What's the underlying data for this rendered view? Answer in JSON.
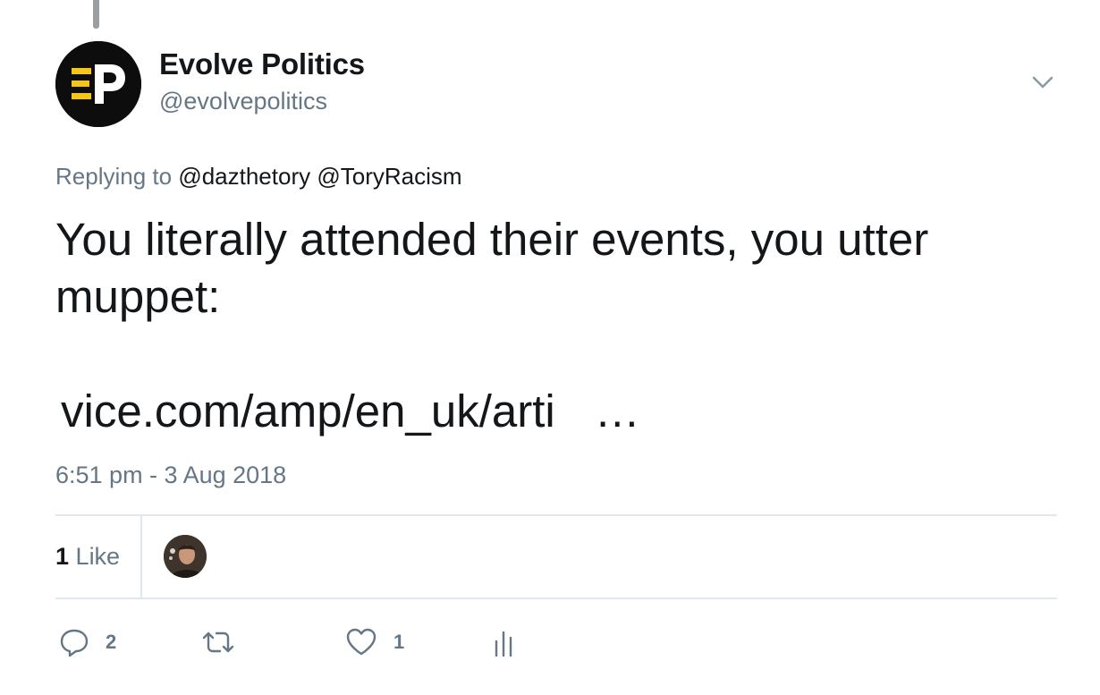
{
  "tweet": {
    "author": {
      "display_name": "Evolve Politics",
      "handle": "@evolvepolitics",
      "avatar_initials": "EP"
    },
    "replying_prefix": "Replying to",
    "replying_mentions": "@dazthetory @ToryRacism",
    "text": "You literally attended their events, you utter muppet:",
    "link_text": "vice.com/amp/en_uk/arti",
    "link_ellipsis": "…",
    "timestamp": "6:51 pm - 3 Aug 2018",
    "likes_number": "1",
    "likes_label": "Like"
  },
  "actions": {
    "reply_count": "2",
    "retweet_count": "",
    "like_count": "1"
  },
  "colors": {
    "text_primary": "#14171a",
    "text_secondary": "#657786",
    "divider": "#e1e8ed",
    "avatar_bg": "#0d0d0d",
    "logo_accent": "#f5c518"
  },
  "icons": [
    "chevron-down-icon",
    "reply-icon",
    "retweet-icon",
    "heart-icon",
    "analytics-icon"
  ]
}
